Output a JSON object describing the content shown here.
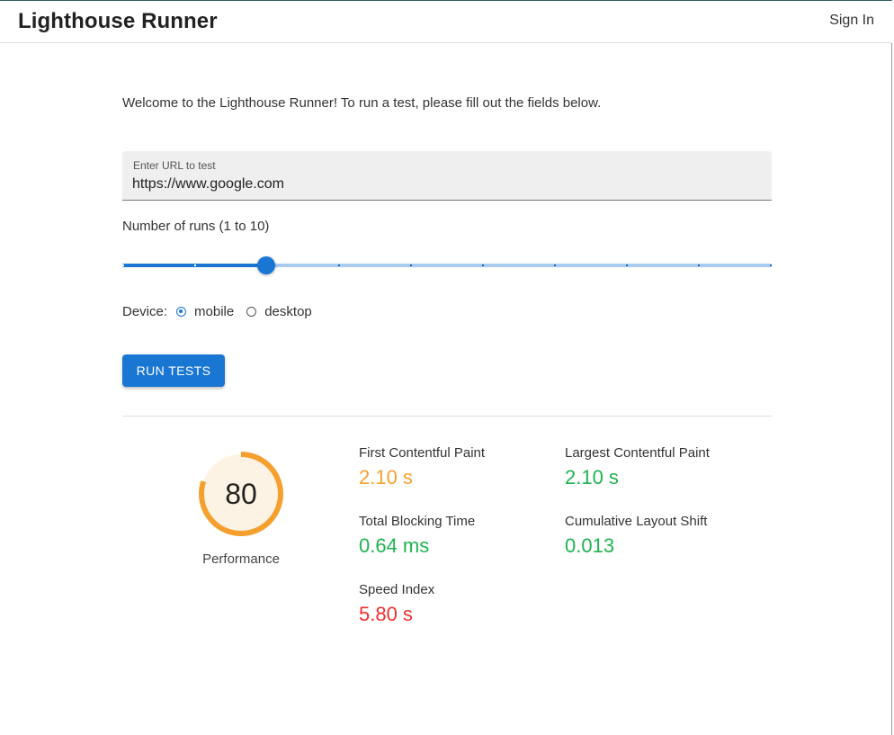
{
  "app": {
    "title": "Lighthouse Runner",
    "sign_in": "Sign In"
  },
  "form": {
    "welcome": "Welcome to the Lighthouse Runner! To run a test, please fill out the fields below.",
    "url_label": "Enter URL to test",
    "url_value": "https://www.google.com",
    "runs_label": "Number of runs (1 to 10)",
    "runs": {
      "min": 1,
      "max": 10,
      "value": 3
    },
    "device_label": "Device:",
    "device_options": [
      "mobile",
      "desktop"
    ],
    "device_selected": "mobile",
    "run_button": "RUN TESTS"
  },
  "results": {
    "score": "80",
    "score_fraction": 0.8,
    "score_label": "Performance",
    "metrics": [
      {
        "label": "First Contentful Paint",
        "value": "2.10 s",
        "color": "#f5a02e"
      },
      {
        "label": "Largest Contentful Paint",
        "value": "2.10 s",
        "color": "#1fb34f"
      },
      {
        "label": "Total Blocking Time",
        "value": "0.64 ms",
        "color": "#1fb34f"
      },
      {
        "label": "Cumulative Layout Shift",
        "value": "0.013",
        "color": "#1fb34f"
      },
      {
        "label": "Speed Index",
        "value": "5.80 s",
        "color": "#ef2f2f"
      }
    ]
  },
  "colors": {
    "accent": "#1976d2",
    "gauge_ring": "#f5a02e",
    "gauge_fill": "#fdf3e4"
  }
}
